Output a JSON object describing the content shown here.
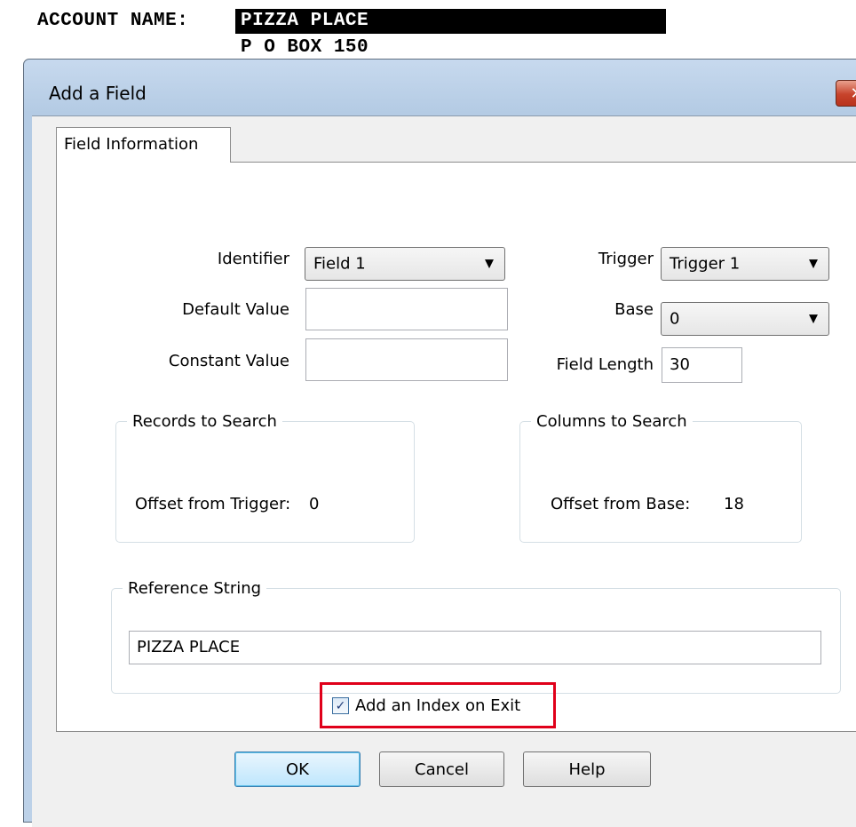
{
  "background": {
    "account_label": "ACCOUNT NAME:",
    "account_value": "PIZZA PLACE",
    "account_address": "P O BOX 150"
  },
  "dialog": {
    "title": "Add a Field",
    "close_glyph": "✕",
    "tab": "Field Information",
    "identifier": {
      "label": "Identifier",
      "value": "Field 1"
    },
    "default_value": {
      "label": "Default Value",
      "value": ""
    },
    "constant_value": {
      "label": "Constant Value",
      "value": ""
    },
    "trigger": {
      "label": "Trigger",
      "value": "Trigger 1"
    },
    "base": {
      "label": "Base",
      "value": "0"
    },
    "field_length": {
      "label": "Field Length",
      "value": "30"
    },
    "records_group": {
      "title": "Records to Search",
      "offset_label": "Offset from Trigger:",
      "offset_value": "0"
    },
    "columns_group": {
      "title": "Columns to Search",
      "offset_label": "Offset from Base:",
      "offset_value": "18"
    },
    "reference_group": {
      "title": "Reference String",
      "value": "PIZZA PLACE"
    },
    "add_index": {
      "label": "Add an Index on Exit",
      "checked": true
    },
    "buttons": {
      "ok": "OK",
      "cancel": "Cancel",
      "help": "Help"
    }
  },
  "colors": {
    "highlight": "#e0001a",
    "title_bar": "#bcd1e8",
    "close_button": "#c7432b"
  },
  "icons": {
    "dropdown": "chevron-down-icon",
    "close": "close-icon",
    "checkbox": "checkmark-icon"
  }
}
